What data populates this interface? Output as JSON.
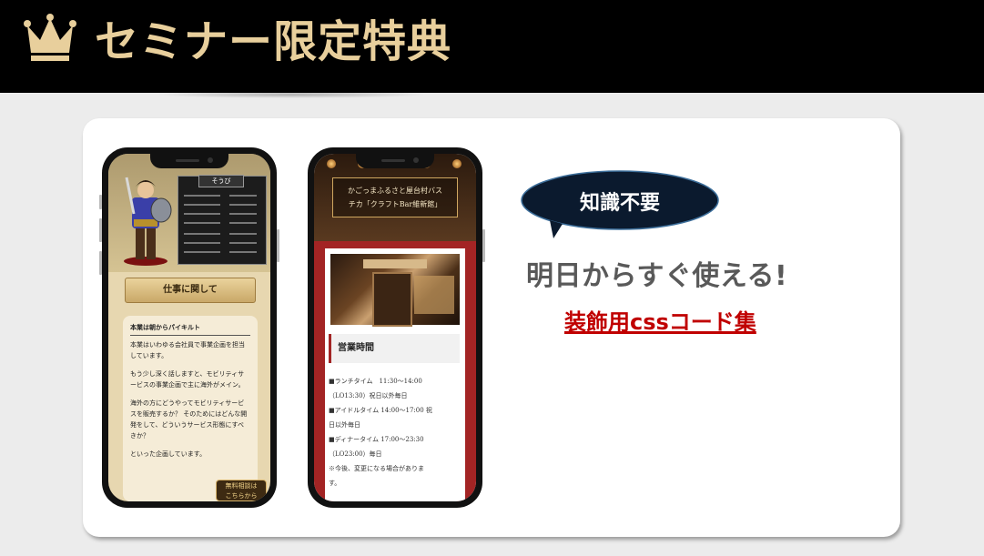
{
  "header": {
    "icon": "crown-icon",
    "title": "セミナー限定特典",
    "title_color": "#e8cf9c",
    "background": "#000000"
  },
  "phone1": {
    "status_tab": "そうび",
    "ribbon": "仕事に関して",
    "heading": "本業は朝からパイキルト",
    "paragraphs": [
      "本業はいわゆる会社員で事業企画を担当しています。",
      "もう少し深く話しますと、モビリティサービスの事業企画で主に海外がメイン。",
      "海外の方にどうやってモビリティサービスを販売するか？ そのためにはどんな開発をして、どういうサービス形態にすべきか？",
      "といった企画しています。"
    ],
    "free_button": [
      "無料相談は",
      "こちらから"
    ]
  },
  "phone2": {
    "title_lines": [
      "かごっまふるさと屋台村バス",
      "チカ「クラフトBar維新館」"
    ],
    "section_title": "営業時間",
    "hours": [
      "■ランチタイム　11:30〜14:00",
      "（LO13:30）祝日以外毎日",
      "■アイドルタイム 14:00〜17:00 祝",
      "日以外毎日",
      "■ディナータイム 17:00〜23:30",
      "（LO23:00）毎日"
    ],
    "note": "※今後、変更になる場合がありま",
    "note2": "す。"
  },
  "promo": {
    "bubble": "知識不要",
    "bubble_color": "#0b1a2e",
    "catch": "明日からすぐ使える!",
    "link": "装飾用cssコード集",
    "link_color": "#c00000"
  }
}
